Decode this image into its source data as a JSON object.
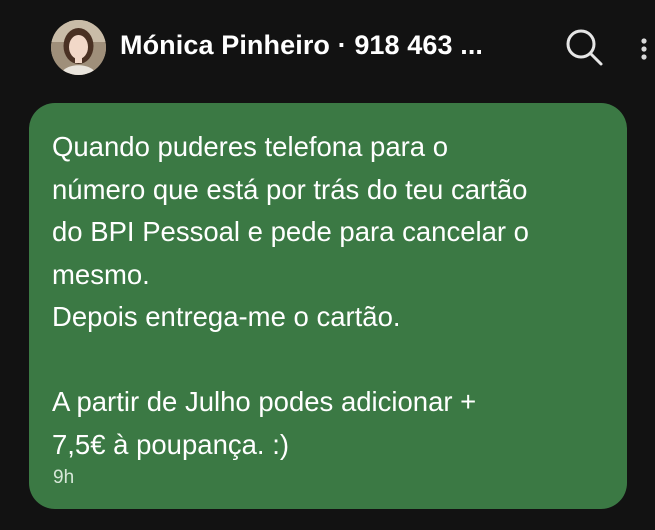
{
  "header": {
    "contact_name": "Mónica Pinheiro · 918 463 ...",
    "avatar_icon": "avatar-photo",
    "search_icon": "search-icon",
    "more_icon": "more-vertical-icon"
  },
  "message": {
    "text": "Quando puderes telefona para o\nnúmero que está por trás do teu cartão\ndo BPI Pessoal e pede para cancelar o\nmesmo.\nDepois entrega-me o cartão.\n\nA partir de Julho podes adicionar +\n7,5€ à poupança. :)",
    "timestamp": "9h"
  },
  "colors": {
    "background": "#121212",
    "bubble": "#3b7944",
    "text": "#ffffff"
  }
}
